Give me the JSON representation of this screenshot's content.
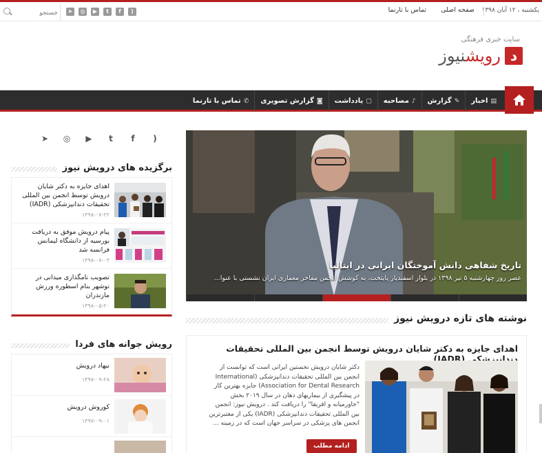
{
  "topbar": {
    "date": "یکشنبه ، ۱۲ آبان ۱۳۹۸",
    "nav": [
      "صفحه اصلی",
      "تماس با تارنما"
    ],
    "search_placeholder": "جستجو"
  },
  "header": {
    "tagline": "سایت خبری فرهنگی",
    "logo_letter": "د",
    "logo_part1": "رویش",
    "logo_part2": "نیوز"
  },
  "nav": {
    "items": [
      {
        "label": "اخبار",
        "icon": "newspaper-icon"
      },
      {
        "label": "گزارش",
        "icon": "edit-icon"
      },
      {
        "label": "مصاحبه",
        "icon": "microphone-icon"
      },
      {
        "label": "یادداشت",
        "icon": "note-icon"
      },
      {
        "label": "گزارش تصویری",
        "icon": "camera-icon"
      },
      {
        "label": "تماس با تارنما",
        "icon": "phone-icon"
      }
    ]
  },
  "social": [
    "rss-icon",
    "facebook-icon",
    "twitter-icon",
    "youtube-icon",
    "instagram-icon",
    "telegram-icon"
  ],
  "sidebar": {
    "featured": {
      "title": "برگزیده های درویش نیوز",
      "items": [
        {
          "title": "اهدای جایزه به دکتر شایان درویش توسط انجمن بین المللی تحقیقات دندانپزشکی (IADR)",
          "date": "۱۳۹۸-۰۷-۲۲"
        },
        {
          "title": "پیام درویش موفق به دریافت بورسیه از دانشگاه لیمانس فرانسه شد",
          "date": "۱۳۹۸-۰۷-۰۳"
        },
        {
          "title": "تصویب نامگذاری میدانی در نوشهر بنام اسطوره ورزش مازندران",
          "date": "۱۳۹۸-۰۵-۲۰"
        }
      ]
    },
    "young": {
      "title": "رویش جوانه های فردا",
      "items": [
        {
          "title": "نیهاد درویش",
          "date": "۱۳۹۷-۰۹-۲۸"
        },
        {
          "title": "کوروش درویش",
          "date": "۱۳۹۷-۰۹-۰۱"
        },
        {
          "title": "",
          "date": ""
        }
      ]
    }
  },
  "slider": {
    "title": "تاریخ شفاهی دانش آموختگان ایرانی در ایتالیا",
    "excerpt": "عصر روز چهارشنبه ۵ تیر ۱۳۹۸ در بلوار اسفندیار پایتخت، به کوشش انجمن مفاخر معماری ایران نشستی با عنوا...",
    "tab_count": 5,
    "active_tab": 2
  },
  "latest": {
    "section_title": "نوشته های تازه درویش نیوز",
    "post": {
      "title": "اهدای جایزه به دکتر شایان درویش توسط انجمن بین المللی تحقیقات دندانپزشکی (IADR)",
      "excerpt": "دکتر شایان درویش نخستین ایرانی است که توانست از انجمن بین المللی تحقیقات دندانپزشکی (International Association for Dental Research) جایزه بهترین کار در پیشگیری از بیماریهای دهان در سال ۲۰۱۹ بخش \"خاورمیانه و افریقا\" را دریافت کند . درویش نیوز: انجمن بین المللی تحقیقات دندانپزشکی (IADR) یکی از معتبرترین انجمن های پزشکی در سراسر جهان است که در زمینه ...",
      "more_label": "ادامه مطلب"
    }
  },
  "colors": {
    "accent": "#b3201f",
    "nav_bg": "#2d2d2d"
  }
}
